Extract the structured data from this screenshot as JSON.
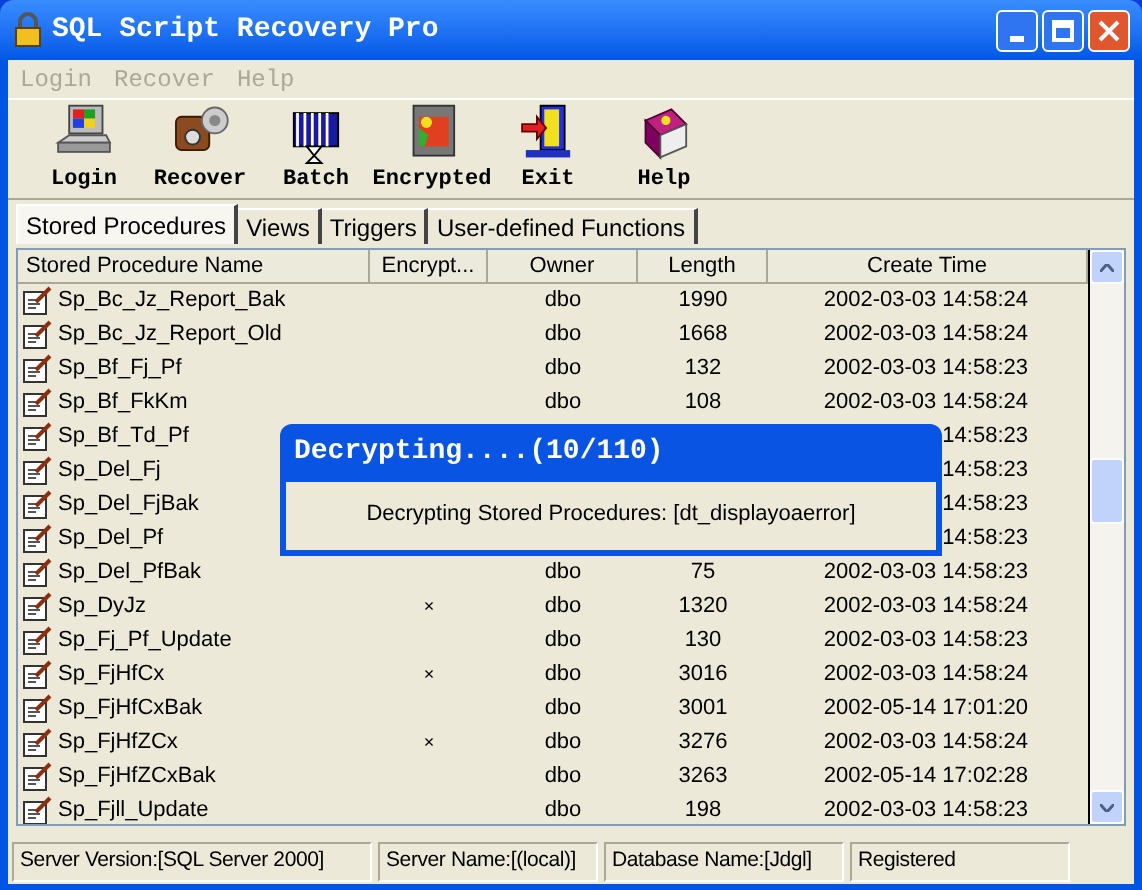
{
  "window": {
    "title": "SQL Script Recovery Pro"
  },
  "menu": [
    {
      "label": "Login",
      "disabled": true
    },
    {
      "label": "Recover",
      "disabled": true
    },
    {
      "label": "Help",
      "disabled": true
    }
  ],
  "toolbar": [
    {
      "label": "Login",
      "kind": "computer"
    },
    {
      "label": "Recover",
      "kind": "camera"
    },
    {
      "label": "Batch",
      "kind": "batch"
    },
    {
      "label": "Encrypted",
      "kind": "encrypted"
    },
    {
      "label": "Exit",
      "kind": "exit"
    },
    {
      "label": "Help",
      "kind": "book"
    }
  ],
  "tabs": [
    {
      "label": "Stored Procedures",
      "selected": true
    },
    {
      "label": "Views",
      "selected": false
    },
    {
      "label": "Triggers",
      "selected": false
    },
    {
      "label": "User-defined Functions",
      "selected": false
    }
  ],
  "table": {
    "columns": [
      "Stored Procedure Name",
      "Encrypt...",
      "Owner",
      "Length",
      "Create Time"
    ],
    "rows": [
      {
        "name": "Sp_Bc_Jz_Report_Bak",
        "owner": "dbo",
        "length": "1990",
        "time": "2002-03-03 14:58:24"
      },
      {
        "name": "Sp_Bc_Jz_Report_Old",
        "owner": "dbo",
        "length": "1668",
        "time": "2002-03-03 14:58:24"
      },
      {
        "name": "Sp_Bf_Fj_Pf",
        "owner": "dbo",
        "length": "132",
        "time": "2002-03-03 14:58:23"
      },
      {
        "name": "Sp_Bf_FkKm",
        "owner": "dbo",
        "length": "108",
        "time": "2002-03-03 14:58:24"
      },
      {
        "name": "Sp_Bf_Td_Pf",
        "time": "14:58:23"
      },
      {
        "name": "Sp_Del_Fj",
        "time": "14:58:23"
      },
      {
        "name": "Sp_Del_FjBak",
        "time": "14:58:23"
      },
      {
        "name": "Sp_Del_Pf",
        "time": "14:58:23"
      },
      {
        "name": "Sp_Del_PfBak",
        "owner": "dbo",
        "length": "75",
        "time": "2002-03-03 14:58:23"
      },
      {
        "name": "Sp_DyJz",
        "encrypted": "×",
        "owner": "dbo",
        "length": "1320",
        "time": "2002-03-03 14:58:24"
      },
      {
        "name": "Sp_Fj_Pf_Update",
        "owner": "dbo",
        "length": "130",
        "time": "2002-03-03 14:58:23"
      },
      {
        "name": "Sp_FjHfCx",
        "encrypted": "×",
        "owner": "dbo",
        "length": "3016",
        "time": "2002-03-03 14:58:24"
      },
      {
        "name": "Sp_FjHfCxBak",
        "owner": "dbo",
        "length": "3001",
        "time": "2002-05-14 17:01:20"
      },
      {
        "name": "Sp_FjHfZCx",
        "encrypted": "×",
        "owner": "dbo",
        "length": "3276",
        "time": "2002-03-03 14:58:24"
      },
      {
        "name": "Sp_FjHfZCxBak",
        "owner": "dbo",
        "length": "3263",
        "time": "2002-05-14 17:02:28"
      },
      {
        "name": "Sp_Fjll_Update",
        "owner": "dbo",
        "length": "198",
        "time": "2002-03-03 14:58:23"
      }
    ]
  },
  "dialog": {
    "title": "Decrypting....(10/110)",
    "message": "Decrypting Stored Procedures: [dt_displayoaerror]"
  },
  "status_bar": [
    "Server Version:[SQL Server 2000]",
    "Server Name:[(local)]",
    "Database Name:[Jdgl]",
    "Registered"
  ]
}
